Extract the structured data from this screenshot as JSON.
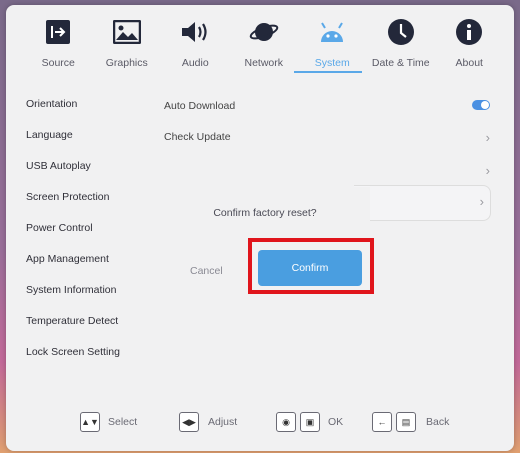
{
  "tabs": [
    {
      "label": "Source",
      "icon": "input-source-icon"
    },
    {
      "label": "Graphics",
      "icon": "image-icon"
    },
    {
      "label": "Audio",
      "icon": "speaker-icon"
    },
    {
      "label": "Network",
      "icon": "planet-icon"
    },
    {
      "label": "System",
      "icon": "android-icon",
      "active": true
    },
    {
      "label": "Date & Time",
      "icon": "clock-icon"
    },
    {
      "label": "About",
      "icon": "info-icon"
    }
  ],
  "menu": [
    "Orientation",
    "Language",
    "USB Autoplay",
    "Screen Protection",
    "Power Control",
    "App Management",
    "System Information",
    "Temperature Detect",
    "Lock Screen Setting"
  ],
  "settings": {
    "auto_download": "Auto Download",
    "check_update": "Check Update"
  },
  "dialog": {
    "message": "Confirm factory reset?",
    "cancel": "Cancel",
    "confirm": "Confirm"
  },
  "bottom": {
    "select": "Select",
    "adjust": "Adjust",
    "ok": "OK",
    "back": "Back"
  },
  "colors": {
    "accent": "#5aa8e8",
    "confirm_bg": "#4a9ee0",
    "highlight": "#e0151c"
  }
}
